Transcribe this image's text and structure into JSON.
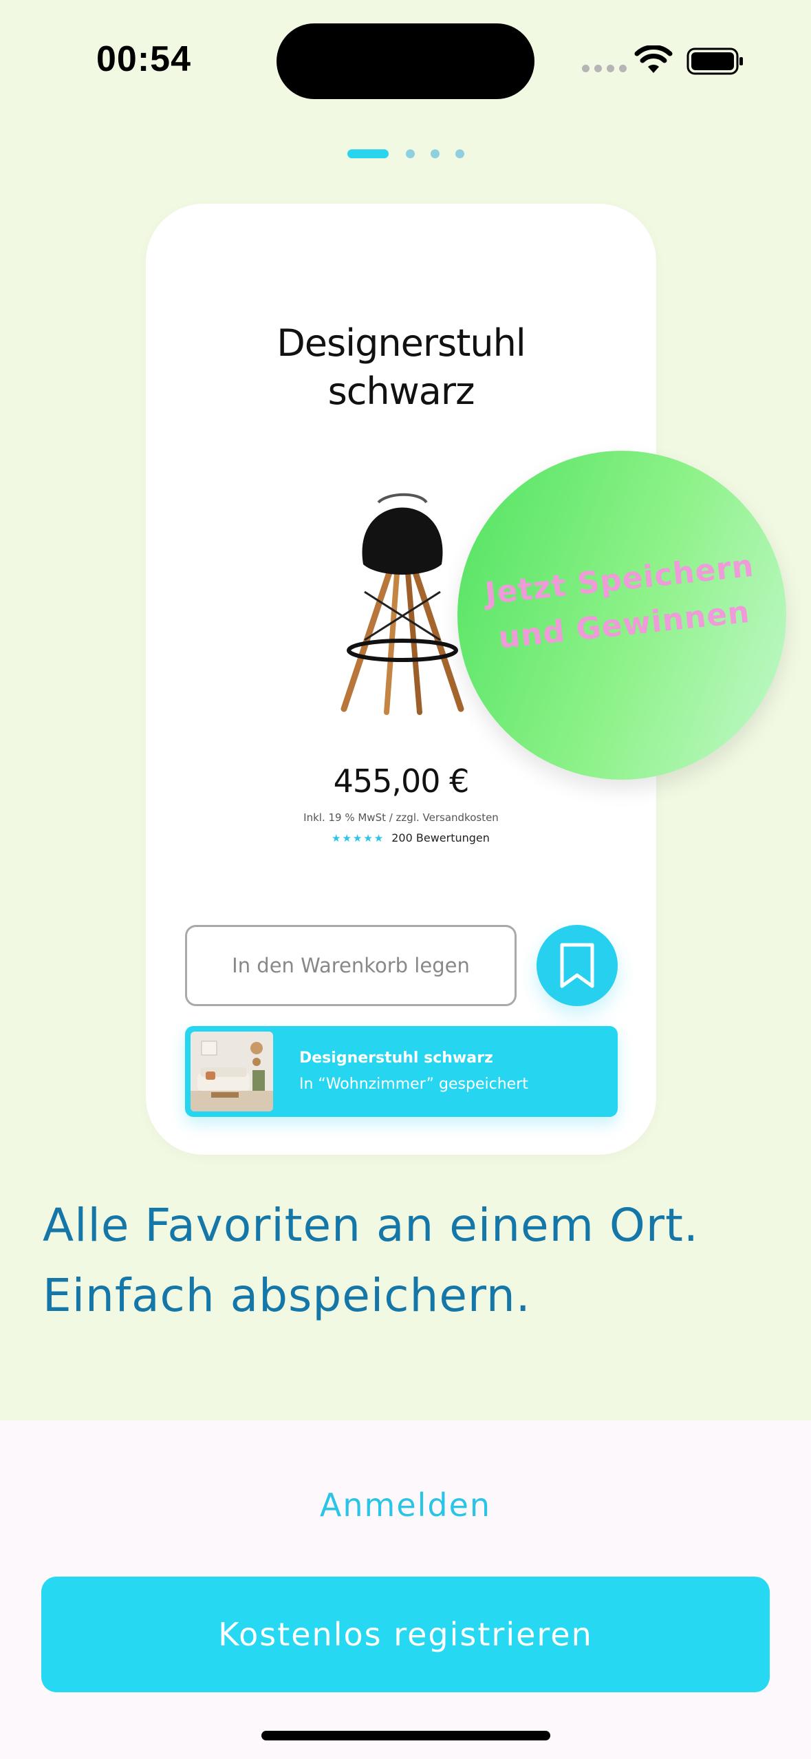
{
  "status_bar": {
    "time": "00:54"
  },
  "pager": {
    "count": 4,
    "active": 1
  },
  "product_card": {
    "title": "Designerstuhl\nschwarz",
    "price": "455,00 €",
    "tax_note": "Inkl. 19 % MwSt / zzgl. Versandkosten",
    "stars": "★★★★★",
    "rating_text": "200 Bewertungen",
    "cart_button_label": "In den Warenkorb legen",
    "saved_toast": {
      "title": "Designerstuhl schwarz",
      "subtitle": "In “Wohnzimmer” gespeichert"
    }
  },
  "promo": {
    "text": "Jetzt Speichern\nund Gewinnen"
  },
  "headline": "Alle Favoriten an einem Ort.\nEinfach abspeichern.",
  "actions": {
    "login_label": "Anmelden",
    "register_label": "Kostenlos registrieren"
  },
  "colors": {
    "accent": "#26d8f1",
    "background_top": "#f1f9e3",
    "headline": "#1576a8",
    "promo_text": "#ef9bd9"
  }
}
